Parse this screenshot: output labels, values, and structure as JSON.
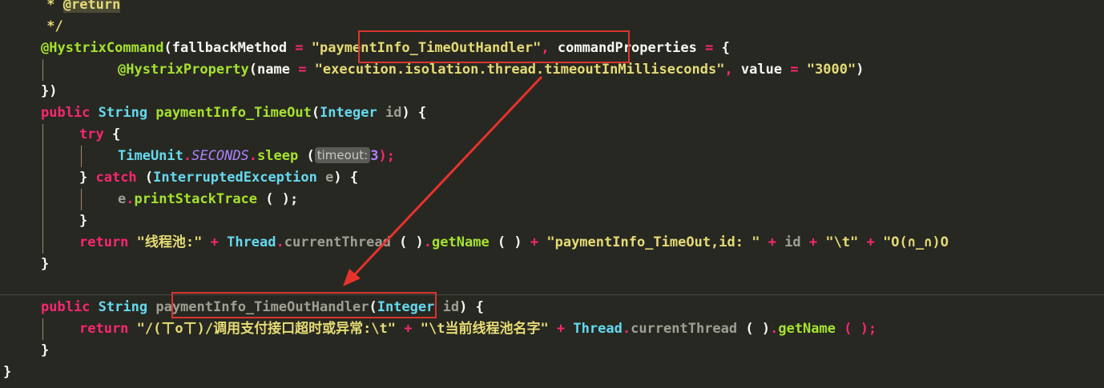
{
  "code": {
    "l0": {
      "star": " * ",
      "tag": "@return"
    },
    "l1": {
      "close": " */"
    },
    "l2": {
      "ann": "@HystrixCommand",
      "p1": "(",
      "attr1": "fallbackMethod",
      "eq1": " = ",
      "str1": "\"paymentInfo_TimeOutHandler\"",
      "comma": ", ",
      "attr2": "commandProperties",
      "eq2": " = ",
      "brace": "{"
    },
    "l3": {
      "ann": "@HystrixProperty",
      "p1": "(",
      "attr1": "name",
      "eq1": " = ",
      "str1": "\"execution.isolation.thread.timeoutInMilliseconds\"",
      "comma": ", ",
      "attr2": "value",
      "eq2": " = ",
      "str2": "\"3000\"",
      "p2": ")"
    },
    "l4": {
      "close": "})"
    },
    "l5": {
      "kw": "public",
      "type": "String",
      "fn": "paymentInfo_TimeOut",
      "p1": "(",
      "ptype": "Integer",
      "pname": "id",
      "p2": ") {"
    },
    "l6": {
      "kw": "try",
      "brace": " {"
    },
    "l7": {
      "cls": "TimeUnit",
      "dot1": ".",
      "const": "SECONDS",
      "dot2": ".",
      "fn": "sleep",
      "p1": " (",
      "hint": "timeout:",
      "num": "3",
      "p2": ");"
    },
    "l8": {
      "brace": "} ",
      "kw": "catch",
      "p1": " (",
      "type": "InterruptedException",
      "var": " e",
      "p2": ") {"
    },
    "l9": {
      "var": "e",
      "dot": ".",
      "fn": "printStackTrace",
      "p": " ( );"
    },
    "l10": {
      "brace": "}"
    },
    "l11": {
      "kw": "return",
      "str1": " \"线程池:\"",
      "plus1": " + ",
      "cls": "Thread",
      "dot1": ".",
      "m1": "currentThread",
      "p1": " ( )",
      "dot2": ".",
      "m2": "getName",
      "p2": " ( )",
      "plus2": " + ",
      "str2": "\"paymentInfo_TimeOut,id: \"",
      "plus3": " + ",
      "var": "id",
      "plus4": " + ",
      "str3": "\"\\t\"",
      "plus5": " + ",
      "str4": "\"O(∩_∩)O"
    },
    "l12": {
      "brace": "}"
    },
    "l13": {
      "kw": "public",
      "type": "String",
      "fn": "paymentInfo_TimeOutHandler",
      "p1": "(",
      "ptype": "Integer",
      "pname": "id",
      "p2": ") {"
    },
    "l14": {
      "kw": "return",
      "str1": " \"/(ㄒoㄒ)/调用支付接口超时或异常:\\t\"",
      "plus1": " + ",
      "str2": "\"\\t当前线程池名字\"",
      "plus2": " + ",
      "cls": "Thread",
      "dot1": ".",
      "m1": "currentThread",
      "p1": " ( )",
      "dot2": ".",
      "m2": "getName",
      "p2": " ( );"
    },
    "l15": {
      "brace": "}"
    },
    "l16": {
      "brace": "}"
    }
  },
  "colors": {
    "background": "#272822",
    "keyword": "#f92672",
    "type": "#66d9ef",
    "function": "#a6e22e",
    "string": "#e6db74",
    "annotation_box": "#d9362f"
  }
}
